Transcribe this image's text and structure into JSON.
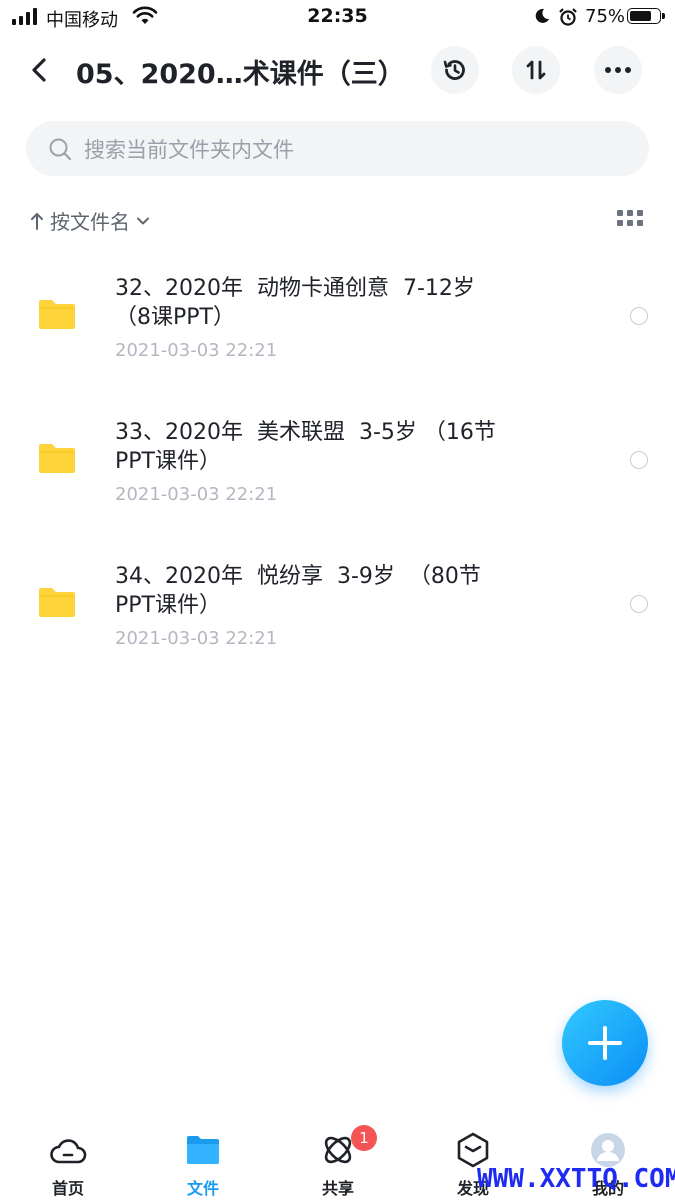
{
  "status_bar": {
    "carrier": "中国移动",
    "time": "22:35",
    "battery_percent": "75%"
  },
  "header": {
    "title": "05、2020…术课件（三）",
    "icons": [
      "back-icon",
      "history-icon",
      "sort-icon",
      "more-icon"
    ]
  },
  "search": {
    "placeholder": "搜索当前文件夹内文件",
    "value": ""
  },
  "sort": {
    "label": "按文件名"
  },
  "files": [
    {
      "name": "32、2020年  动物卡通创意  7-12岁\n（8课PPT）",
      "date": "2021-03-03 22:21"
    },
    {
      "name": "33、2020年  美术联盟  3-5岁 （16节\nPPT课件）",
      "date": "2021-03-03 22:21"
    },
    {
      "name": "34、2020年  悦纷享  3-9岁  （80节\nPPT课件）",
      "date": "2021-03-03 22:21"
    }
  ],
  "tabs": {
    "home": "首页",
    "files": "文件",
    "share": "共享",
    "share_badge": "1",
    "discover": "发现",
    "mine": "我的"
  },
  "watermark": "WWW.XXTTQ.COM",
  "colors": {
    "accent": "#1a9bf0",
    "folder": "#ffd43b",
    "badge": "#f45454",
    "watermark": "#1e2bf0"
  }
}
